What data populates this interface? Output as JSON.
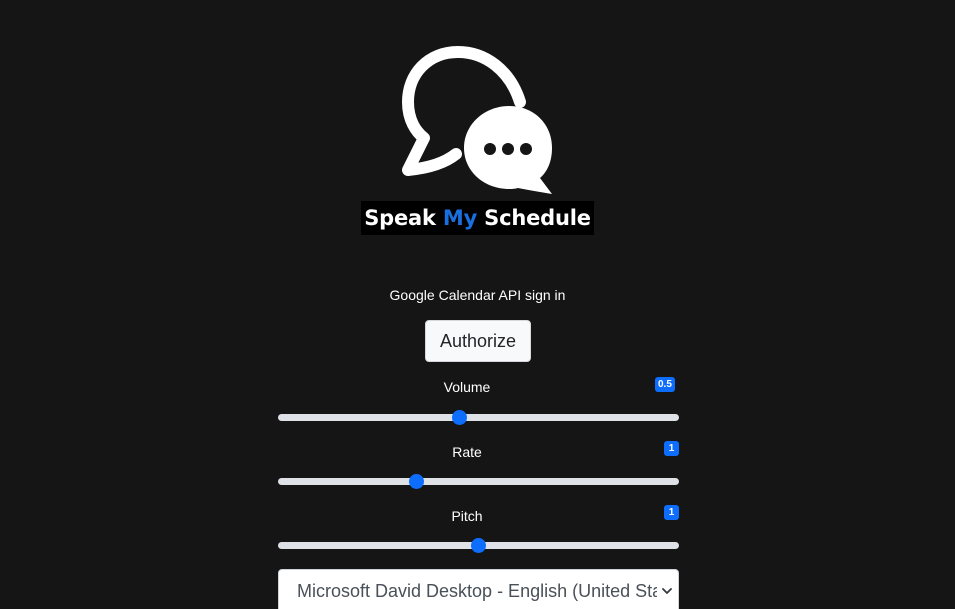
{
  "logo": {
    "word1": "Speak ",
    "word2": "My",
    "word3": " Schedule",
    "icon": "speech-bubbles-icon",
    "accent_color": "#1a6fe0"
  },
  "signin": {
    "label": "Google Calendar API sign in",
    "button_label": "Authorize"
  },
  "sliders": {
    "volume": {
      "label": "Volume",
      "value": "0.5",
      "fraction": 0.45
    },
    "rate": {
      "label": "Rate",
      "value": "1",
      "fraction": 0.34
    },
    "pitch": {
      "label": "Pitch",
      "value": "1",
      "fraction": 0.5
    }
  },
  "voice": {
    "selected": "Microsoft David Desktop - English (United States)"
  },
  "colors": {
    "background": "#151515",
    "primary": "#0d6efd",
    "track": "#dee2e6"
  }
}
